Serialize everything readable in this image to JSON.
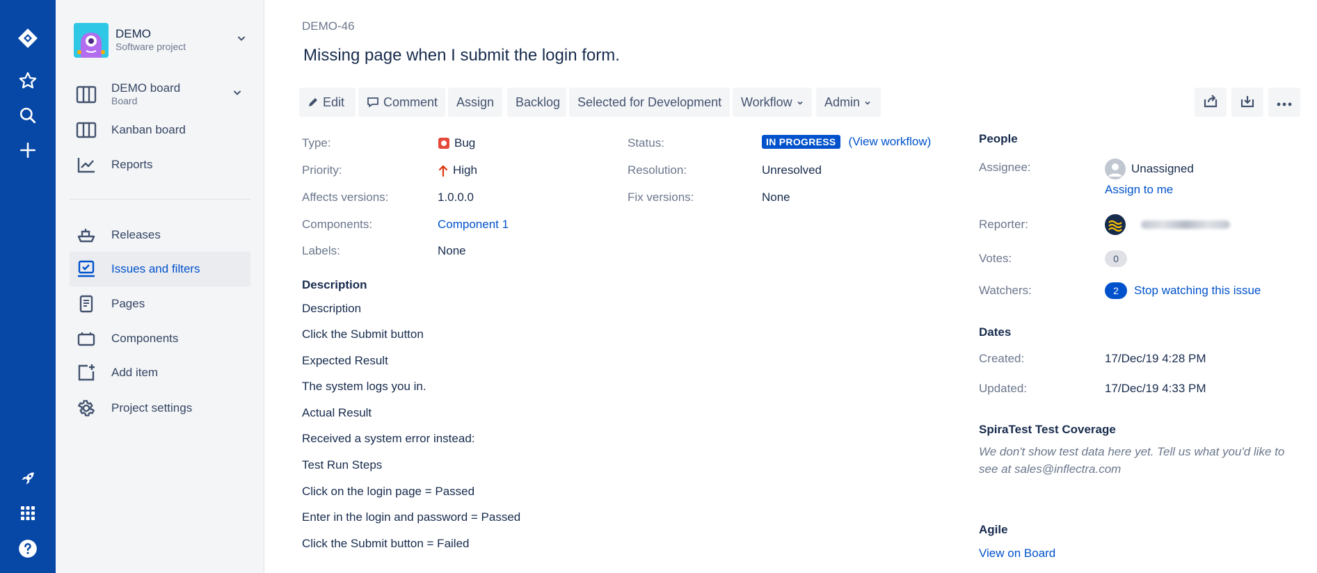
{
  "issue": {
    "key": "DEMO-46",
    "summary": "Missing page when I submit the login form."
  },
  "project": {
    "name": "DEMO",
    "type": "Software project"
  },
  "sidebar": {
    "board": {
      "name": "DEMO board",
      "sub": "Board"
    },
    "items": [
      {
        "label": "Kanban board",
        "icon": "kanban-icon"
      },
      {
        "label": "Reports",
        "icon": "reports-icon"
      },
      {
        "label": "Releases",
        "icon": "releases-icon"
      },
      {
        "label": "Issues and filters",
        "icon": "issues-icon",
        "active": true
      },
      {
        "label": "Pages",
        "icon": "pages-icon"
      },
      {
        "label": "Components",
        "icon": "components-icon"
      },
      {
        "label": "Add item",
        "icon": "add-item-icon"
      },
      {
        "label": "Project settings",
        "icon": "gear-icon"
      }
    ]
  },
  "toolbar": {
    "edit": "Edit",
    "comment": "Comment",
    "assign": "Assign",
    "backlog": "Backlog",
    "selected_for_dev": "Selected for Development",
    "workflow": "Workflow",
    "admin": "Admin"
  },
  "details": {
    "type_label": "Type:",
    "type_value": "Bug",
    "priority_label": "Priority:",
    "priority_value": "High",
    "affects_label": "Affects versions:",
    "affects_value": "1.0.0.0",
    "components_label": "Components:",
    "components_value": "Component 1",
    "labels_label": "Labels:",
    "labels_value": "None",
    "status_label": "Status:",
    "status_value": "IN PROGRESS",
    "view_workflow": "View workflow",
    "resolution_label": "Resolution:",
    "resolution_value": "Unresolved",
    "fix_label": "Fix versions:",
    "fix_value": "None"
  },
  "description": {
    "heading": "Description",
    "lines": [
      "Description",
      "Click the Submit button",
      "Expected Result",
      "The system logs you in.",
      "Actual Result",
      "Received a system error instead:",
      "Test Run Steps",
      "Click on the login page = Passed",
      "Enter in the login and password = Passed",
      "Click the Submit button = Failed"
    ]
  },
  "people": {
    "heading": "People",
    "assignee_label": "Assignee:",
    "assignee_value": "Unassigned",
    "assign_to_me": "Assign to me",
    "reporter_label": "Reporter:",
    "votes_label": "Votes:",
    "votes_value": "0",
    "watchers_label": "Watchers:",
    "watchers_value": "2",
    "stop_watching": "Stop watching this issue"
  },
  "dates": {
    "heading": "Dates",
    "created_label": "Created:",
    "created_value": "17/Dec/19 4:28 PM",
    "updated_label": "Updated:",
    "updated_value": "17/Dec/19 4:33 PM"
  },
  "spira": {
    "heading": "SpiraTest Test Coverage",
    "message": "We don't show test data here yet. Tell us what you'd like to see at sales@inflectra.com"
  },
  "agile": {
    "heading": "Agile",
    "view_on_board": "View on Board"
  },
  "colors": {
    "nav": "#0747a6",
    "link": "#0052cc",
    "sidebar": "#f4f5f7",
    "bug": "#e5493a",
    "priority_high": "#de350b"
  }
}
